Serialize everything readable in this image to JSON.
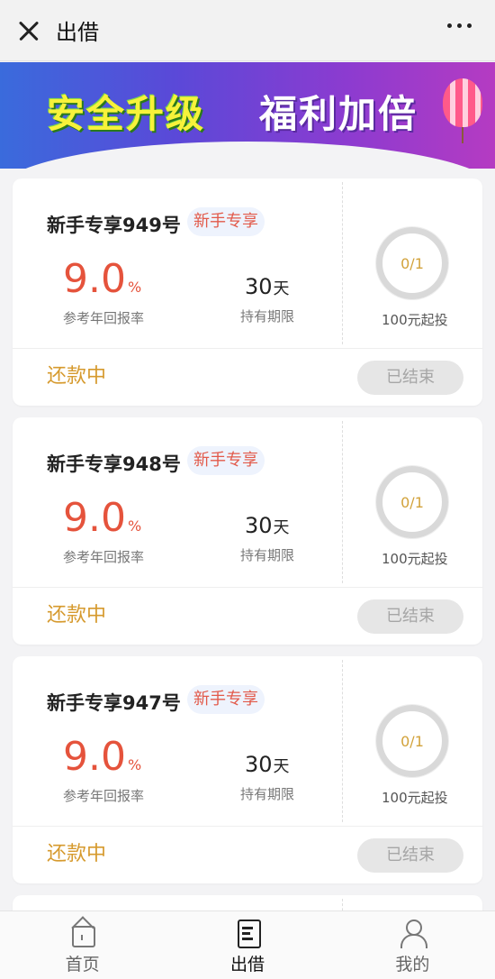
{
  "header": {
    "title": "出借"
  },
  "banner": {
    "left_text": "安全升级",
    "right_text": "福利加倍"
  },
  "products": [
    {
      "name": "新手专享949号",
      "tag": "新手专享",
      "rate": "9.0",
      "rate_unit": "%",
      "rate_label": "参考年回报率",
      "term": "30",
      "term_unit": "天",
      "term_label": "持有期限",
      "progress": "0/1",
      "min_invest": "100元起投",
      "status": "还款中",
      "action": "已结束"
    },
    {
      "name": "新手专享948号",
      "tag": "新手专享",
      "rate": "9.0",
      "rate_unit": "%",
      "rate_label": "参考年回报率",
      "term": "30",
      "term_unit": "天",
      "term_label": "持有期限",
      "progress": "0/1",
      "min_invest": "100元起投",
      "status": "还款中",
      "action": "已结束"
    },
    {
      "name": "新手专享947号",
      "tag": "新手专享",
      "rate": "9.0",
      "rate_unit": "%",
      "rate_label": "参考年回报率",
      "term": "30",
      "term_unit": "天",
      "term_label": "持有期限",
      "progress": "0/1",
      "min_invest": "100元起投",
      "status": "还款中",
      "action": "已结束"
    }
  ],
  "nav": [
    {
      "label": "首页",
      "icon": "home-icon",
      "active": false
    },
    {
      "label": "出借",
      "icon": "document-icon",
      "active": true
    },
    {
      "label": "我的",
      "icon": "user-icon",
      "active": false
    }
  ],
  "colors": {
    "rate": "#e5533c",
    "status": "#d69a2e",
    "tag_text": "#e25a4a",
    "ring": "#d9d9d9"
  }
}
